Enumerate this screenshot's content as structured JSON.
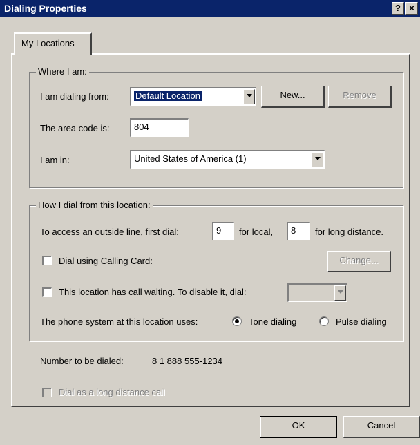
{
  "window": {
    "title": "Dialing Properties",
    "help_glyph": "?",
    "close_glyph": "×"
  },
  "tab": {
    "label": "My Locations"
  },
  "where": {
    "legend": "Where I am:",
    "dialing_from_label": "I am dialing from:",
    "location_value": "Default Location",
    "new_label": "New...",
    "remove_label": "Remove",
    "area_code_label": "The area code is:",
    "area_code_value": "804",
    "country_label": "I am in:",
    "country_value": "United States of America (1)"
  },
  "how": {
    "legend": "How I dial from this location:",
    "outside_line_label": "To access an outside line, first dial:",
    "local_value": "9",
    "for_local": "for local,",
    "long_distance_value": "8",
    "for_long_distance": "for long distance.",
    "calling_card_label": "Dial using Calling Card:",
    "change_label": "Change...",
    "call_waiting_label": "This location has call waiting. To disable it, dial:",
    "phone_system_label": "The phone system at this location uses:",
    "tone_label": "Tone dialing",
    "pulse_label": "Pulse dialing",
    "selected_dialing": "Tone dialing"
  },
  "number": {
    "label": "Number to be dialed:",
    "value": "8 1 888 555-1234"
  },
  "long_distance_checkbox": {
    "label": "Dial as a long distance call"
  },
  "buttons": {
    "ok": "OK",
    "cancel": "Cancel"
  }
}
